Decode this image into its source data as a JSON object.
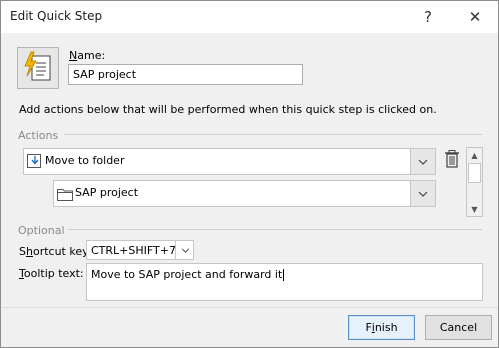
{
  "window": {
    "title": "Edit Quick Step",
    "help_glyph": "?",
    "close_glyph": "✕"
  },
  "name": {
    "label_underlined": "N",
    "label_rest": "ame:",
    "value": "SAP project"
  },
  "description": "Add actions below that will be performed when this quick step is clicked on.",
  "actions": {
    "section_label": "Actions",
    "action1": {
      "label": "Move to folder"
    },
    "action1_folder": {
      "label": "SAP project"
    }
  },
  "optional": {
    "section_label": "Optional",
    "shortcut_label_pre": "S",
    "shortcut_label_ul": "h",
    "shortcut_label_post": "ortcut key:",
    "shortcut_value": "CTRL+SHIFT+7",
    "tooltip_label_ul": "T",
    "tooltip_label_rest": "ooltip text:",
    "tooltip_value": "Move to SAP project and forward it"
  },
  "footer": {
    "finish_pre": "F",
    "finish_ul": "i",
    "finish_post": "nish",
    "cancel_label": "Cancel"
  }
}
